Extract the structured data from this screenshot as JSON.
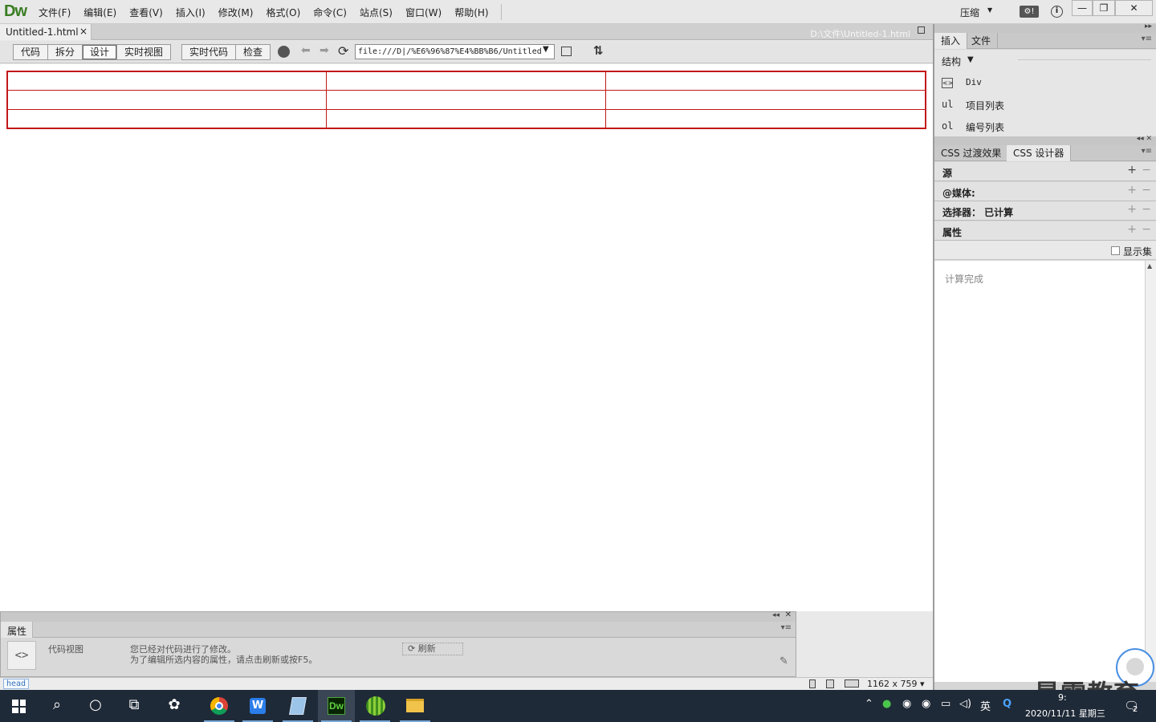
{
  "app": {
    "logo": "Dw",
    "menu": [
      "文件(F)",
      "编辑(E)",
      "查看(V)",
      "插入(I)",
      "修改(M)",
      "格式(O)",
      "命令(C)",
      "站点(S)",
      "窗口(W)",
      "帮助(H)"
    ],
    "workspace": "压缩",
    "window_controls": {
      "minimize": "—",
      "maximize": "❐",
      "close": "✕"
    }
  },
  "document": {
    "tab_title": "Untitled-1.html",
    "tab_close": "×",
    "path": "D:\\文件\\Untitled-1.html"
  },
  "toolbar": {
    "view_buttons": [
      "代码",
      "拆分",
      "设计",
      "实时视图"
    ],
    "active_view": "设计",
    "live_buttons": [
      "实时代码",
      "检查"
    ],
    "address": "file:///D|/%E6%96%87%E4%BB%B6/Untitled",
    "refresh_glyph": "⟳",
    "sort_glyph": "⇅"
  },
  "design_table": {
    "rows": 3,
    "cols": 3,
    "border_color": "#c21818"
  },
  "properties_panel": {
    "tab": "属性",
    "code_view_label": "代码视图",
    "message_line1": "您已经对代码进行了修改。",
    "message_line2": "为了编辑所选内容的属性，请点击刷新或按F5。",
    "refresh_label": "刷新",
    "code_icon": "<>"
  },
  "statusbar": {
    "tag": "head",
    "size": "1162 x 759",
    "size_caret": "▾"
  },
  "right_dock": {
    "insert_tabs": [
      "插入",
      "文件"
    ],
    "insert_category": "结构",
    "insert_items": [
      {
        "icon": "<>",
        "label": "Div"
      },
      {
        "icon": "ul",
        "label": "项目列表"
      },
      {
        "icon": "ol",
        "label": "编号列表"
      }
    ],
    "css_tabs": [
      "CSS 过渡效果",
      "CSS 设计器"
    ],
    "css_sections": [
      "源",
      "@媒体:",
      "选择器： 已计算",
      "属性"
    ],
    "show_set_label": "显示集",
    "computed_status": "计算完成"
  },
  "watermark": "最需教育",
  "taskbar": {
    "apps": [
      "start",
      "search",
      "cortana",
      "task-view",
      "pinwheel",
      "chrome",
      "wps",
      "notepad",
      "dreamweaver",
      "melon",
      "explorer"
    ],
    "tray": {
      "ime": "英",
      "time": "9:",
      "date": "2020/11/11 星期三",
      "notification_count": "2"
    }
  }
}
